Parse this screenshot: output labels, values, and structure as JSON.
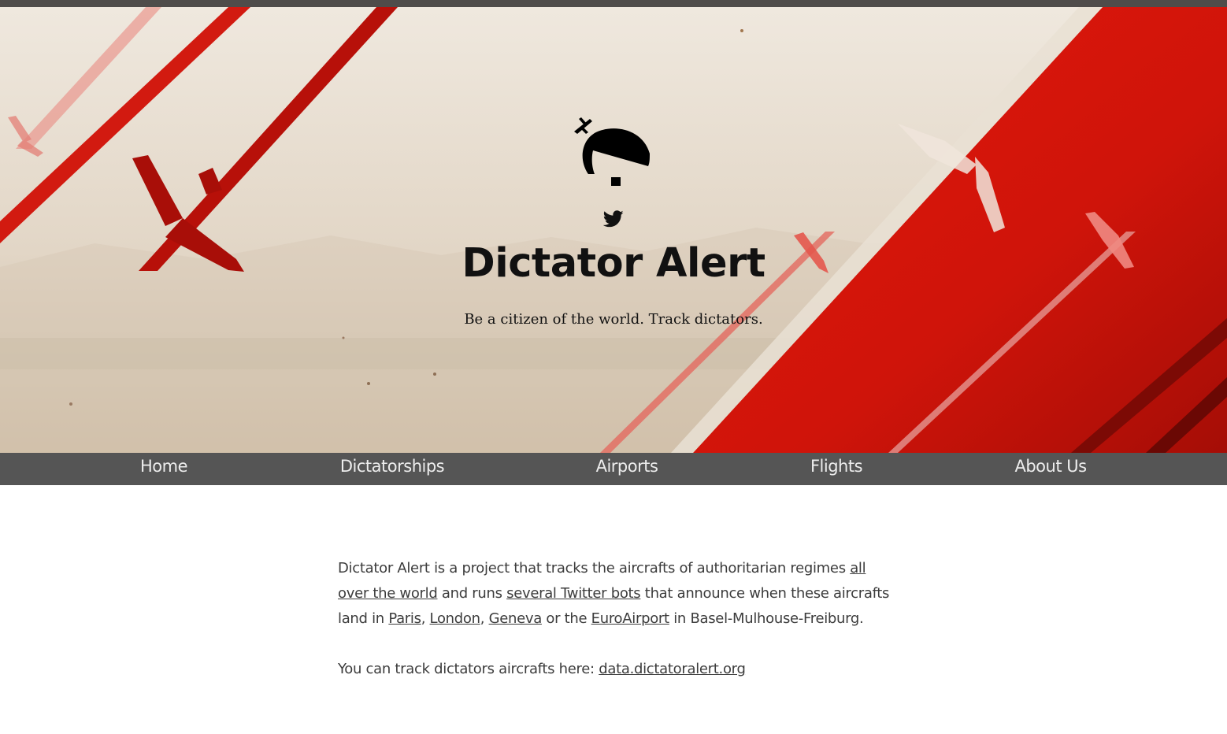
{
  "site": {
    "title": "Dictator Alert",
    "tagline": "Be a citizen of the world. Track dictators."
  },
  "icons": {
    "logo": "dictator-alert-logo",
    "twitter": "twitter-icon"
  },
  "colors": {
    "accent_red": "#d8160b",
    "nav_background": "#555555",
    "top_bar": "#4f4c4a",
    "text": "#3c3c3c"
  },
  "nav": {
    "items": [
      {
        "label": "Home"
      },
      {
        "label": "Dictatorships"
      },
      {
        "label": "Airports"
      },
      {
        "label": "Flights"
      },
      {
        "label": "About Us"
      }
    ]
  },
  "intro": {
    "t1": "Dictator Alert is a project that tracks the aircrafts of authoritarian regimes ",
    "link_world": "all over the world",
    "t2": " and runs ",
    "link_bots": "several Twitter bots",
    "t3": " that announce when these aircrafts land in ",
    "link_paris": "Paris",
    "t4": ", ",
    "link_london": "London",
    "t5": ", ",
    "link_geneva": "Geneva",
    "t6": " or the ",
    "link_euroairport": "EuroAirport",
    "t7": " in Basel-Mulhouse-Freiburg."
  },
  "track": {
    "text": "You can track dictators aircrafts here: ",
    "link": "data.dictatoralert.org"
  }
}
